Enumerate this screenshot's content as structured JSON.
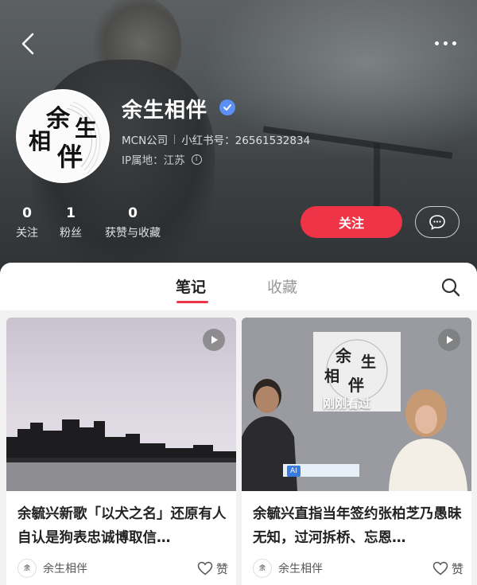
{
  "profile": {
    "nickname": "余生相伴",
    "company": "MCN公司",
    "xhs_id": "小红书号：26561532834",
    "ip_location": "IP属地：江苏",
    "avatar_logo_chars": [
      "余",
      "生",
      "相",
      "伴"
    ]
  },
  "stats": [
    {
      "value": "0",
      "label": "关注"
    },
    {
      "value": "1",
      "label": "粉丝"
    },
    {
      "value": "0",
      "label": "获赞与收藏"
    }
  ],
  "actions": {
    "follow_label": "关注"
  },
  "tabs": [
    {
      "label": "笔记",
      "active": true
    },
    {
      "label": "收藏",
      "active": false
    }
  ],
  "notes": [
    {
      "title": "余毓兴新歌「以犬之名」还原有人自认是狗表忠诚博取信…",
      "author": "余生相伴",
      "like_label": "赞"
    },
    {
      "title": "余毓兴直指当年签约张柏芝乃愚昧无知，过河拆桥、忘恩…",
      "author": "余生相伴",
      "like_label": "赞",
      "overlay": "刚刚看过"
    }
  ],
  "colors": {
    "accent": "#ee3446",
    "verified": "#5b8ff6"
  },
  "icons": [
    "back-icon",
    "more-icon",
    "verified-icon",
    "info-icon",
    "message-icon",
    "search-icon",
    "play-icon",
    "heart-icon"
  ]
}
